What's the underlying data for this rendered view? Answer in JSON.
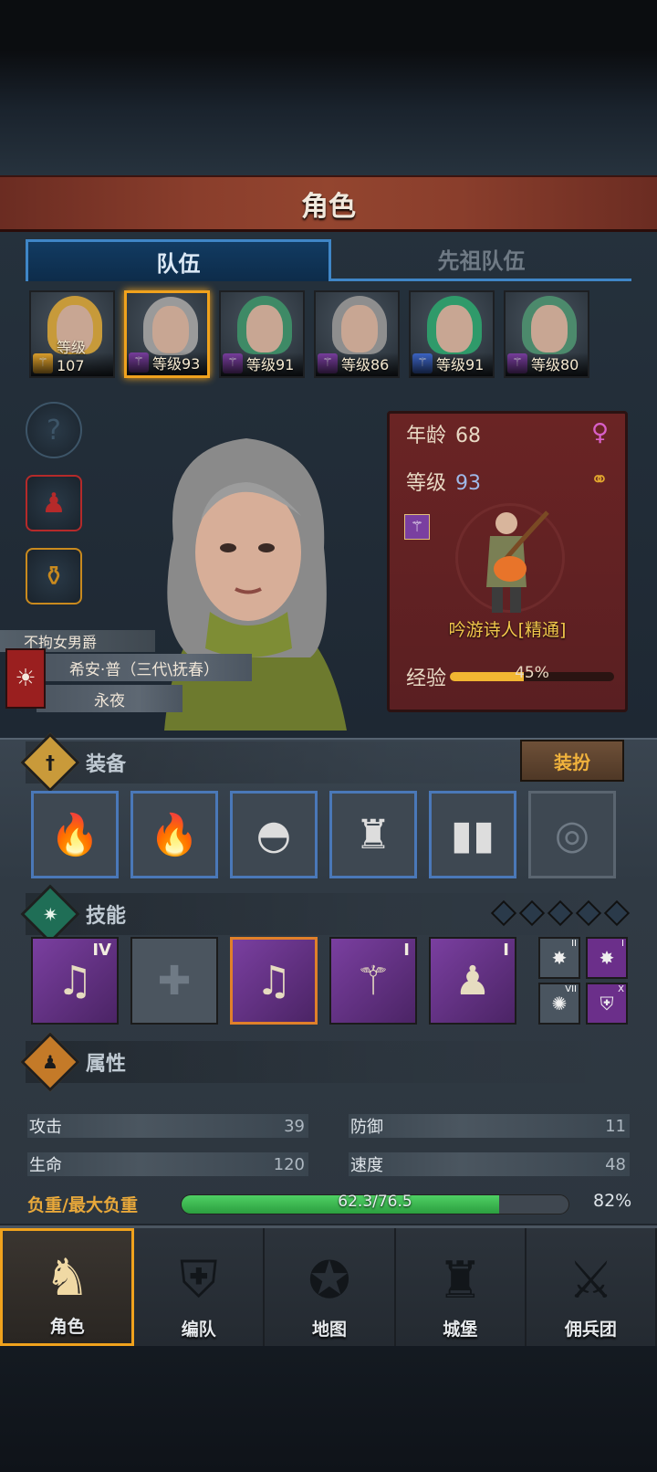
{
  "header": {
    "title": "角色"
  },
  "tabs": [
    {
      "label": "队伍",
      "active": true
    },
    {
      "label": "先祖队伍",
      "active": false
    }
  ],
  "team": [
    {
      "level_label": "等级107",
      "hair": "#c79a3a",
      "class_color": "#e0a22d",
      "selected": false
    },
    {
      "level_label": "等级93",
      "hair": "#9a9a9a",
      "class_color": "#7a3fa0",
      "selected": true
    },
    {
      "level_label": "等级91",
      "hair": "#3e8a66",
      "class_color": "#7a3fa0",
      "selected": false
    },
    {
      "level_label": "等级86",
      "hair": "#8e8e8e",
      "class_color": "#7a3fa0",
      "selected": false
    },
    {
      "level_label": "等级91",
      "hair": "#2f9a6a",
      "class_color": "#3d66c8",
      "selected": false
    },
    {
      "level_label": "等级80",
      "hair": "#4c8a6c",
      "class_color": "#7a3fa0",
      "selected": false
    }
  ],
  "side_icons": [
    {
      "name": "help-icon",
      "glyph": "?",
      "color": "#3d5568"
    },
    {
      "name": "bust-icon",
      "glyph": "♟",
      "color": "#b52a2a"
    },
    {
      "name": "potion-icon",
      "glyph": "⚱",
      "color": "#c98a1e"
    }
  ],
  "character": {
    "title_label": "不拘女男爵",
    "name": "希安·普（三代\\抚春）",
    "house": "永夜",
    "age_label": "年龄",
    "age": "68",
    "level_label": "等级",
    "level": "93",
    "job": "吟游诗人[精通]",
    "exp_label": "经验",
    "exp_percent": 45,
    "exp_text": "45%"
  },
  "equipment": {
    "title": "装备",
    "dress_button": "装扮",
    "slots": [
      {
        "name": "lute-weapon-slot",
        "glyph": "🔥"
      },
      {
        "name": "lute-offhand-slot",
        "glyph": "🔥"
      },
      {
        "name": "hood-slot",
        "glyph": "◓"
      },
      {
        "name": "armor-slot",
        "glyph": "♜"
      },
      {
        "name": "boots-slot",
        "glyph": "▮▮"
      },
      {
        "name": "ring-slot",
        "glyph": "◎"
      }
    ]
  },
  "skills": {
    "title": "技能",
    "items": [
      {
        "name": "song-skill-iv",
        "glyph": "♫",
        "tag": "IV",
        "empty": false
      },
      {
        "name": "empty-skill-slot",
        "glyph": "✚",
        "tag": "",
        "empty": true
      },
      {
        "name": "crystal-song-skill",
        "glyph": "♫",
        "tag": "",
        "empty": false
      },
      {
        "name": "staff-skill-i",
        "glyph": "⚚",
        "tag": "I",
        "empty": false
      },
      {
        "name": "party-buff-skill-i",
        "glyph": "♟",
        "tag": "I",
        "empty": false
      }
    ],
    "passives": [
      {
        "name": "passive-burst-ii",
        "glyph": "✸",
        "tag": "II",
        "color": "#4a5560"
      },
      {
        "name": "passive-burst-i",
        "glyph": "✸",
        "tag": "I",
        "color": "#6b2f8a"
      },
      {
        "name": "passive-frost-vii",
        "glyph": "✺",
        "tag": "VII",
        "color": "#4a5560"
      },
      {
        "name": "passive-shield-x",
        "glyph": "⛨",
        "tag": "X",
        "color": "#6b2f8a"
      }
    ]
  },
  "attributes": {
    "title": "属性",
    "attack_label": "攻击",
    "attack": "39",
    "defense_label": "防御",
    "defense": "11",
    "hp_label": "生命",
    "hp": "120",
    "speed_label": "速度",
    "speed": "48",
    "load_label": "负重/最大负重",
    "load_text": "62.3/76.5",
    "load_fraction": 0.82,
    "load_percent": "82%"
  },
  "nav": [
    {
      "name": "nav-character",
      "label": "角色",
      "glyph": "♞",
      "active": true
    },
    {
      "name": "nav-formation",
      "label": "编队",
      "glyph": "⛨",
      "active": false
    },
    {
      "name": "nav-map",
      "label": "地图",
      "glyph": "✪",
      "active": false
    },
    {
      "name": "nav-castle",
      "label": "城堡",
      "glyph": "♜",
      "active": false
    },
    {
      "name": "nav-mercenaries",
      "label": "佣兵团",
      "glyph": "⚔",
      "active": false
    }
  ]
}
